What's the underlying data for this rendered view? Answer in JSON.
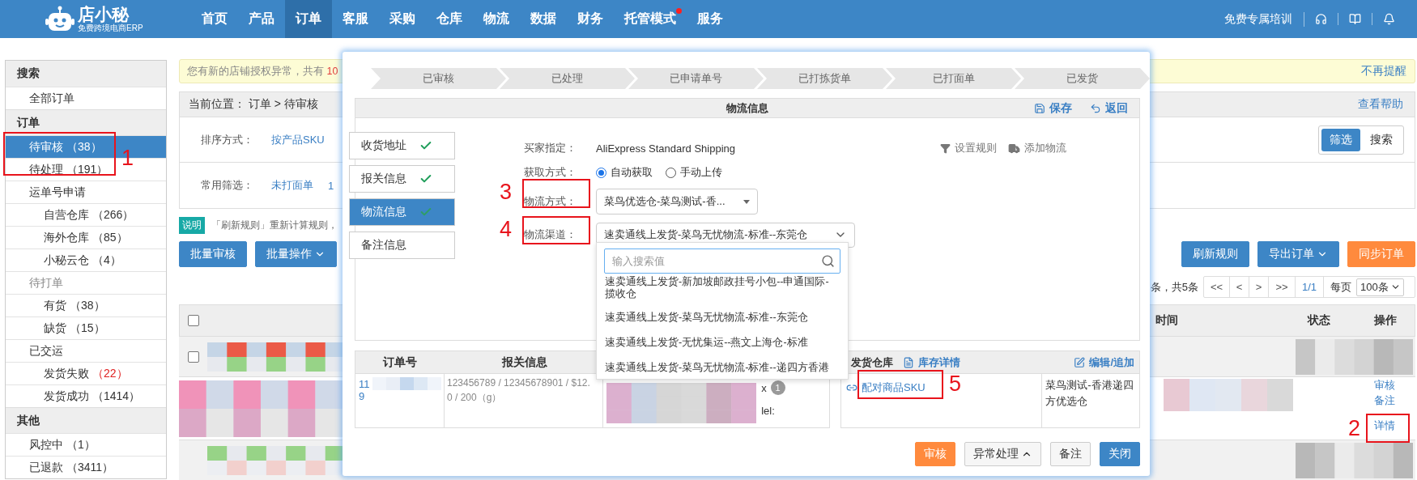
{
  "nav": {
    "logo": "店小秘",
    "tagline": "免费跨境电商ERP",
    "items": [
      {
        "label": "首页",
        "selected": false,
        "dot": false
      },
      {
        "label": "产品",
        "selected": false,
        "dot": false
      },
      {
        "label": "订单",
        "selected": true,
        "dot": false
      },
      {
        "label": "客服",
        "selected": false,
        "dot": false
      },
      {
        "label": "采购",
        "selected": false,
        "dot": false
      },
      {
        "label": "仓库",
        "selected": false,
        "dot": false
      },
      {
        "label": "物流",
        "selected": false,
        "dot": false
      },
      {
        "label": "数据",
        "selected": false,
        "dot": false
      },
      {
        "label": "财务",
        "selected": false,
        "dot": false
      },
      {
        "label": "托管模式",
        "selected": false,
        "dot": true
      },
      {
        "label": "服务",
        "selected": false,
        "dot": false
      }
    ],
    "training": "免费专属培训"
  },
  "sidebar": [
    {
      "title": "搜索",
      "items": [
        {
          "label": "全部订单",
          "selected": false,
          "muted": false,
          "alert": false
        }
      ]
    },
    {
      "title": "订单",
      "items": [
        {
          "label": "待审核",
          "count": "（38）",
          "selected": true,
          "muted": false,
          "alert": false
        },
        {
          "label": "待处理",
          "count": "（191）",
          "selected": false,
          "muted": false,
          "alert": false
        },
        {
          "label": "运单号申请",
          "selected": false,
          "muted": false,
          "alert": false,
          "children": [
            {
              "label": "自营仓库",
              "count": "（266）",
              "selected": false,
              "alert": false
            },
            {
              "label": "海外仓库",
              "count": "（85）",
              "selected": false,
              "alert": false
            },
            {
              "label": "小秘云仓",
              "count": "（4）",
              "selected": false,
              "alert": false
            }
          ]
        },
        {
          "label": "待打单",
          "selected": false,
          "muted": true,
          "alert": false,
          "children": [
            {
              "label": "有货",
              "count": "（38）",
              "selected": false,
              "alert": false
            },
            {
              "label": "缺货",
              "count": "（15）",
              "selected": false,
              "alert": false
            }
          ]
        },
        {
          "label": "已交运",
          "selected": false,
          "muted": false,
          "alert": false,
          "children": [
            {
              "label": "发货失败",
              "count": "（22）",
              "selected": false,
              "alert": true
            },
            {
              "label": "发货成功",
              "count": "（1414）",
              "selected": false,
              "alert": false
            }
          ]
        }
      ]
    },
    {
      "title": "其他",
      "items": [
        {
          "label": "风控中",
          "count": "（1）",
          "selected": false,
          "muted": false,
          "alert": false
        },
        {
          "label": "已退款",
          "count": "（3411）",
          "selected": false,
          "muted": false,
          "alert": false
        }
      ]
    }
  ],
  "notice": {
    "text": "您有新的店铺授权异常，共有 ",
    "highlight": "10",
    "dismiss": "不再提醒"
  },
  "breadcrumb": {
    "label": "当前位置：",
    "path": "订单 > 待审核",
    "help": "查看帮助"
  },
  "filters": [
    {
      "label": "排序方式：",
      "options": [
        "按产品SKU"
      ]
    },
    {
      "label": "常用筛选：",
      "options": [
        "未打面单",
        "1"
      ]
    }
  ],
  "view_toggle": [
    {
      "label": "筛选",
      "selected": true
    },
    {
      "label": "搜索",
      "selected": false
    }
  ],
  "hint": {
    "badge": "说明",
    "text": "「刷新规则」重新计算规则，"
  },
  "actions_left": [
    {
      "label": "批量审核",
      "kind": "primary",
      "dropdown": false
    },
    {
      "label": "批量操作",
      "kind": "primary",
      "dropdown": true
    }
  ],
  "actions_right": [
    {
      "label": "刷新规则",
      "kind": "primary",
      "dropdown": false
    },
    {
      "label": "导出订单",
      "kind": "primary",
      "dropdown": true
    },
    {
      "label": "同步订单",
      "kind": "warning",
      "dropdown": false
    }
  ],
  "pagination": {
    "summary": "条，共5条",
    "buttons": [
      "<<",
      "<",
      ">",
      ">>"
    ],
    "page": "1/1",
    "per_page_label": "每页",
    "per_page": "100条"
  },
  "table": {
    "header_checkbox": {
      "checked": false
    },
    "columns": [
      "时间",
      "状态",
      "操作"
    ],
    "rows": [
      {
        "kind": "selectable",
        "checked": false
      },
      {
        "kind": "detail",
        "actions": [
          "审核",
          "备注",
          "详情"
        ]
      },
      {
        "kind": "blurred"
      }
    ]
  },
  "modal": {
    "steps": [
      "已审核",
      "已处理",
      "已申请单号",
      "已打拣货单",
      "已打面单",
      "已发货"
    ],
    "panel": {
      "title": "物流信息",
      "save": "保存",
      "back": "返回"
    },
    "tabs": [
      {
        "label": "收货地址",
        "selected": false,
        "done": true
      },
      {
        "label": "报关信息",
        "selected": false,
        "done": true
      },
      {
        "label": "物流信息",
        "selected": true,
        "done": true
      },
      {
        "label": "备注信息",
        "selected": false,
        "done": false
      }
    ],
    "form": {
      "buyer_label": "买家指定：",
      "buyer_value": "AliExpress Standard Shipping",
      "rules": "设置规则",
      "add": "添加物流",
      "fetch_label": "获取方式：",
      "fetch_options": [
        {
          "label": "自动获取",
          "selected": true
        },
        {
          "label": "手动上传",
          "selected": false
        }
      ],
      "method_label": "物流方式：",
      "method_value": "菜鸟优选仓-菜鸟测试-香...",
      "channel_label": "物流渠道：",
      "channel_value": "速卖通线上发货-菜鸟无忧物流-标准--东莞仓"
    },
    "channel_dropdown": {
      "placeholder": "输入搜索值",
      "options": [
        "速卖通线上发货-新加坡邮政挂号小包--申通国际-揽收仓",
        "速卖通线上发货-菜鸟无忧物流-标准--东莞仓",
        "速卖通线上发货-无忧集运--燕文上海仓-标准",
        "速卖通线上发货-菜鸟无忧物流-标准--递四方香港"
      ]
    },
    "order_table": {
      "columns": [
        "订单号",
        "报关信息"
      ],
      "order_start": "11",
      "order_end": "9",
      "customs_lines": [
        "123456789 / 12345678901 / $12.",
        "0 / 200（g）"
      ],
      "qty_prefix": "x",
      "qty": "1",
      "model_label": "lel:"
    },
    "warehouse": {
      "title": "发货仓库",
      "stock": "库存详情",
      "edit": "编辑/追加",
      "pair": "配对商品SKU",
      "name": "菜鸟测试-香港递四方优选仓"
    },
    "footer": [
      {
        "label": "审核",
        "kind": "warning",
        "dropdown": false
      },
      {
        "label": "异常处理",
        "kind": "default",
        "dropdown": true
      },
      {
        "label": "备注",
        "kind": "default",
        "dropdown": false
      },
      {
        "label": "关闭",
        "kind": "primary",
        "dropdown": false
      }
    ]
  },
  "annotations": [
    "1",
    "2",
    "3",
    "4",
    "5"
  ]
}
